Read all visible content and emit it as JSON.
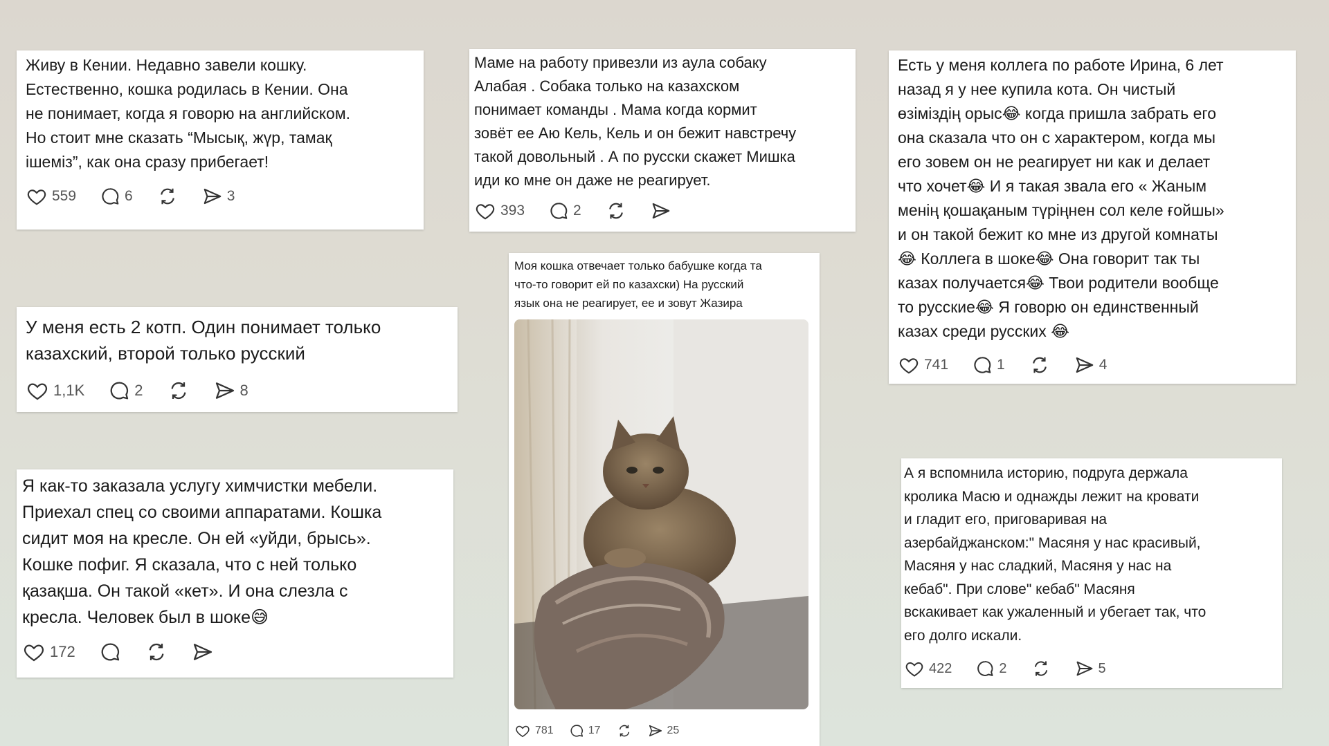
{
  "posts": [
    {
      "text": "Живу в Кении. Недавно завели кошку.\nЕстественно, кошка родилась в Кении. Она\nне понимает, когда я говорю на английском.\nНо стоит мне сказать “Мысық, жүр, тамақ\nішеміз”, как она сразу прибегает!",
      "likes": "559",
      "comments": "6",
      "shares": "3"
    },
    {
      "text": "Маме на работу привезли из аула собаку\nАлабая . Собака только на казахском\nпонимает команды . Мама когда кормит\nзовёт ее Аю Кель, Кель и он бежит навстречу\nтакой довольный . А по русски скажет Мишка\nиди ко мне он даже не реагирует.",
      "likes": "393",
      "comments": "2",
      "shares": ""
    },
    {
      "text": "Есть у меня коллега по работе Ирина, 6 лет\nназад я у нее купила кота. Он чистый\nөзіміздің орыс😂 когда пришла забрать его\nона сказала что он с характером, когда мы\nего зовем он не реагирует ни как и делает\nчто хочет😂 И я такая звала его « Жаным\nменің қошақаным түріңнен сол келе ғойшы»\nи он такой бежит ко мне из другой комнаты\n😂 Коллега в шоке😂 Она говорит так ты\nказах получается😂 Твои родители вообще\nто русские😂 Я говорю он единственный\nказах среди русских 😂",
      "likes": "741",
      "comments": "1",
      "shares": "4"
    },
    {
      "text": "У меня есть 2 котп. Один понимает только\nказахский, второй только русский",
      "likes": "1,1K",
      "comments": "2",
      "shares": "8"
    },
    {
      "text": "Моя кошка отвечает только бабушке когда та\nчто-то говорит ей по казахски) На русский\nязык она не реагирует, ее и зовут Жазира",
      "likes": "781",
      "comments": "17",
      "shares": "25"
    },
    {
      "text": "Я как-то заказала услугу химчистки мебели.\nПриехал спец со своими аппаратами. Кошка\nсидит моя на кресле. Он ей «уйди, брысь».\nКошке пофиг. Я сказала, что с ней только\nқазақша. Он такой «кет». И она слезла с\nкресла. Человек был в шоке😅",
      "likes": "172",
      "comments": "",
      "shares": ""
    },
    {
      "text": "А я вспомнила  историю, подруга держала\nкролика Масю и однажды лежит на кровати\nи гладит его, приговаривая на\nазербайджанском:\" Масяня у нас  красивый,\nМасяня у нас  сладкий, Масяня  у нас на\nкебаб\". При слове\" кебаб\" Масяня\nвскакивает как ужаленный и убегает так, что\nего долго искали.",
      "likes": "422",
      "comments": "2",
      "shares": "5"
    }
  ],
  "icons": {
    "like": "heart-icon",
    "comment": "comment-icon",
    "repost": "repost-icon",
    "share": "share-icon"
  }
}
